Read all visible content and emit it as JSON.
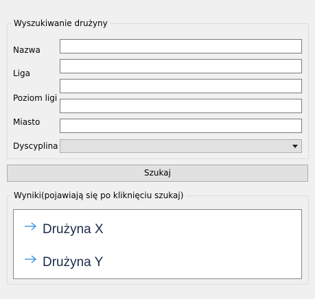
{
  "search_group": {
    "title": "Wyszukiwanie drużyny",
    "fields": {
      "nazwa": {
        "label": "Nazwa",
        "value": ""
      },
      "liga": {
        "label": "Liga",
        "value": ""
      },
      "poziom_ligi": {
        "label": "Poziom ligi",
        "value": ""
      },
      "miasto": {
        "label": "Miasto",
        "value": ""
      }
    },
    "dyscyplina": {
      "label": "Dyscyplina",
      "selected": ""
    },
    "search_button": "Szukaj"
  },
  "results_group": {
    "title": "Wyniki(pojawiają się po kliknięciu szukaj)",
    "items": [
      {
        "label": "Drużyna X",
        "icon": "arrow-right-icon"
      },
      {
        "label": "Drużyna Y",
        "icon": "arrow-right-icon"
      }
    ]
  },
  "colors": {
    "window_bg": "#f0f0f0",
    "button_bg": "#e1e1e1",
    "accent_arrow": "#2b8be0",
    "result_text": "#1b2a4a"
  }
}
